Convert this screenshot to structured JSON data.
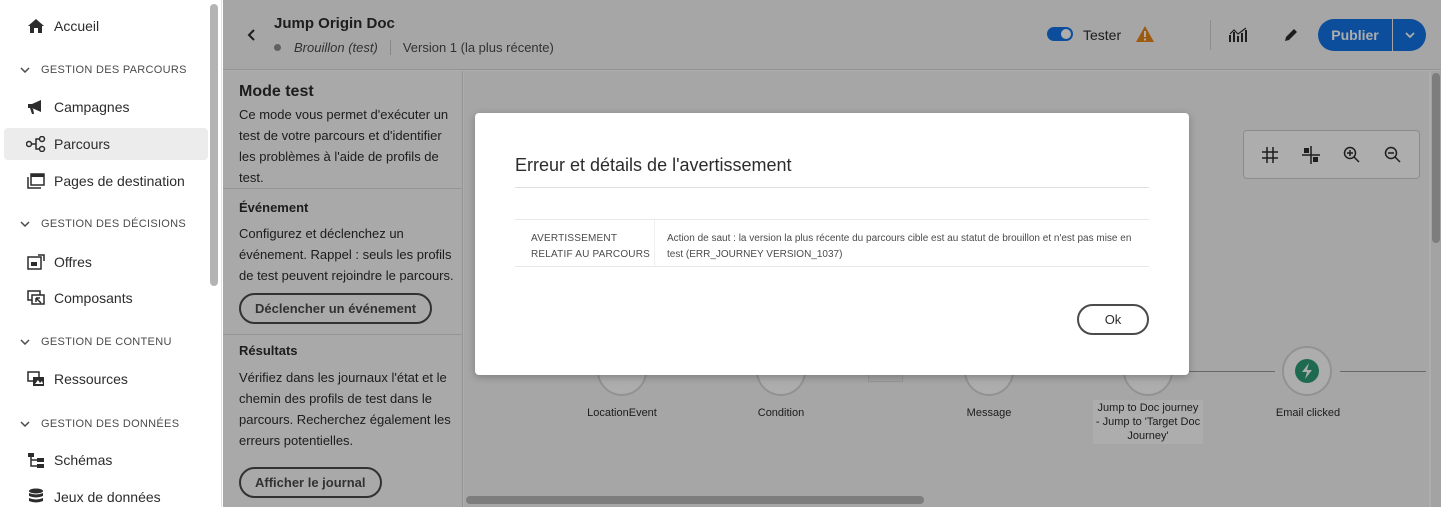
{
  "sidebar": {
    "home": "Accueil",
    "sections": [
      {
        "title": "GESTION DES PARCOURS"
      },
      {
        "title": "GESTION DES DÉCISIONS"
      },
      {
        "title": "GESTION DE CONTENU"
      },
      {
        "title": "GESTION DES DONNÉES"
      }
    ],
    "items": {
      "campagnes": "Campagnes",
      "parcours": "Parcours",
      "pages": "Pages de destination",
      "offres": "Offres",
      "composants": "Composants",
      "ressources": "Ressources",
      "schemas": "Schémas",
      "jeux": "Jeux de données"
    }
  },
  "header": {
    "title": "Jump Origin Doc",
    "status": "Brouillon (test)",
    "version": "Version 1 (la plus récente)",
    "toggle_label": "Tester",
    "publish_label": "Publier"
  },
  "test_panel": {
    "title": "Mode test",
    "intro": "Ce mode vous permet d'exécuter un test de votre parcours et d'identifier les problèmes à l'aide de profils de test.",
    "event_title": "Événement",
    "event_text": "Configurez et déclenchez un événement. Rappel : seuls les profils de test peuvent rejoindre le parcours.",
    "event_button": "Déclencher un événement",
    "results_title": "Résultats",
    "results_text": "Vérifiez dans les journaux l'état et le chemin des profils de test dans le parcours. Recherchez également les erreurs potentielles.",
    "log_button": "Afficher le journal"
  },
  "canvas": {
    "nodes": {
      "location": "LocationEvent",
      "condition": "Condition",
      "message": "Message",
      "jump": "Jump to Doc journey - Jump to 'Target Doc Journey'",
      "email": "Email clicked"
    }
  },
  "dialog": {
    "title": "Erreur et détails de l'avertissement",
    "key": "AVERTISSEMENT RELATIF AU PARCOURS",
    "message": "Action de saut : la version la plus récente du parcours cible est au statut de brouillon et n'est pas mise en test (ERR_JOURNEY VERSION_1037)",
    "ok": "Ok"
  },
  "colors": {
    "accent": "#1473e6",
    "warning": "#e68619",
    "email_node": "#2d9d78"
  }
}
